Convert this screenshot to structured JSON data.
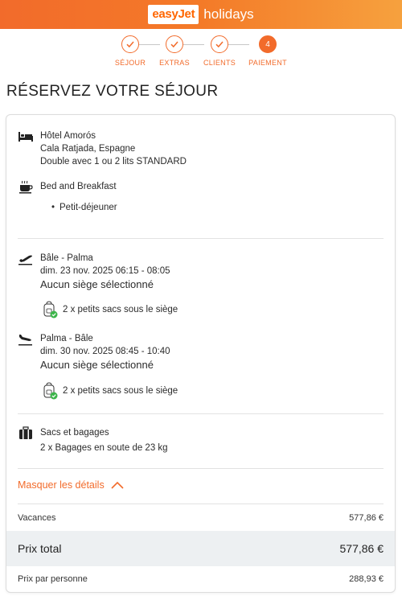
{
  "header": {
    "brand": "easyJet",
    "suffix": "holidays"
  },
  "steps": [
    {
      "label": "SÉJOUR",
      "state": "done"
    },
    {
      "label": "EXTRAS",
      "state": "done"
    },
    {
      "label": "CLIENTS",
      "state": "done"
    },
    {
      "label": "PAIEMENT",
      "state": "active",
      "number": "4"
    }
  ],
  "page_title": "RÉSERVEZ VOTRE SÉJOUR",
  "hotel": {
    "name": "Hôtel Amorós",
    "location": "Cala Ratjada, Espagne",
    "room": "Double avec 1 ou 2 lits STANDARD"
  },
  "board": {
    "type": "Bed and Breakfast",
    "items": [
      "Petit-déjeuner"
    ]
  },
  "flights": [
    {
      "route": "Bâle - Palma",
      "datetime": "dim. 23 nov. 2025 06:15 - 08:05",
      "seat": "Aucun siège sélectionné",
      "bags": "2 x petits sacs sous le siège"
    },
    {
      "route": "Palma - Bâle",
      "datetime": "dim. 30 nov. 2025 08:45 - 10:40",
      "seat": "Aucun siège sélectionné",
      "bags": "2 x petits sacs sous le siège"
    }
  ],
  "luggage": {
    "title": "Sacs et bagages",
    "detail": "2 x Bagages en soute de 23 kg"
  },
  "toggle_label": "Masquer les détails",
  "pricing": {
    "holiday_label": "Vacances",
    "holiday_value": "577,86 €",
    "total_label": "Prix total",
    "total_value": "577,86 €",
    "per_person_label": "Prix par personne",
    "per_person_value": "288,93 €"
  },
  "colors": {
    "accent": "#f26b2b",
    "success": "#3cb54a",
    "total_bg": "#edf0f2"
  }
}
